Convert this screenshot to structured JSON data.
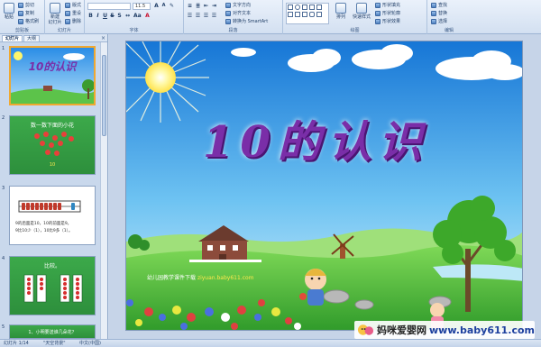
{
  "ribbon": {
    "clipboard": {
      "paste": "粘贴",
      "cut": "剪切",
      "copy": "复制",
      "format_painter": "格式刷",
      "label": "剪贴板"
    },
    "slides": {
      "new_slide": "新建\n幻灯片",
      "layout": "版式",
      "reset": "重设",
      "delete": "删除",
      "label": "幻灯片"
    },
    "font": {
      "size": "11.5",
      "label": "字体"
    },
    "paragraph": {
      "text_direction": "文字方向",
      "align_text": "对齐文本",
      "smartart": "转换为 SmartArt",
      "label": "段落"
    },
    "drawing": {
      "arrange": "排列",
      "quick_styles": "快速样式",
      "shape_fill": "形状填充",
      "shape_outline": "形状轮廓",
      "shape_effects": "形状效果",
      "label": "绘图"
    },
    "editing": {
      "find": "查找",
      "replace": "替换",
      "select": "选择",
      "label": "编辑"
    }
  },
  "panel": {
    "tabs": [
      "幻灯片",
      "大纲"
    ],
    "close": "×",
    "slides": [
      {
        "number": "1",
        "title": "10的认识"
      },
      {
        "number": "2",
        "title": "数一数下面的小花",
        "count_label": "10"
      },
      {
        "number": "3",
        "line1": "9的后面是10，10的前面是9。",
        "line2": "9比10少（1），10比9多（1）。"
      },
      {
        "number": "4",
        "title": "比较。"
      },
      {
        "number": "5",
        "title": "1、小明要送谁几朵花？"
      }
    ]
  },
  "slide": {
    "title": "10的认识",
    "credit_text": "幼儿园教学课件下载",
    "credit_site": "ziyuan.baby611.com"
  },
  "status": {
    "slide_pos": "幻灯片 1/14",
    "theme": "\"天空背景\"",
    "language": "中文(中国)"
  },
  "watermark": {
    "brand": "妈咪爱婴网",
    "url": "www.baby611.com"
  },
  "colors": {
    "title": "#7a2ea8",
    "ribbon_bg": "#d3e0f1",
    "selected_thumb_border": "#f0a830",
    "thumb_green": "#3ca94a"
  }
}
